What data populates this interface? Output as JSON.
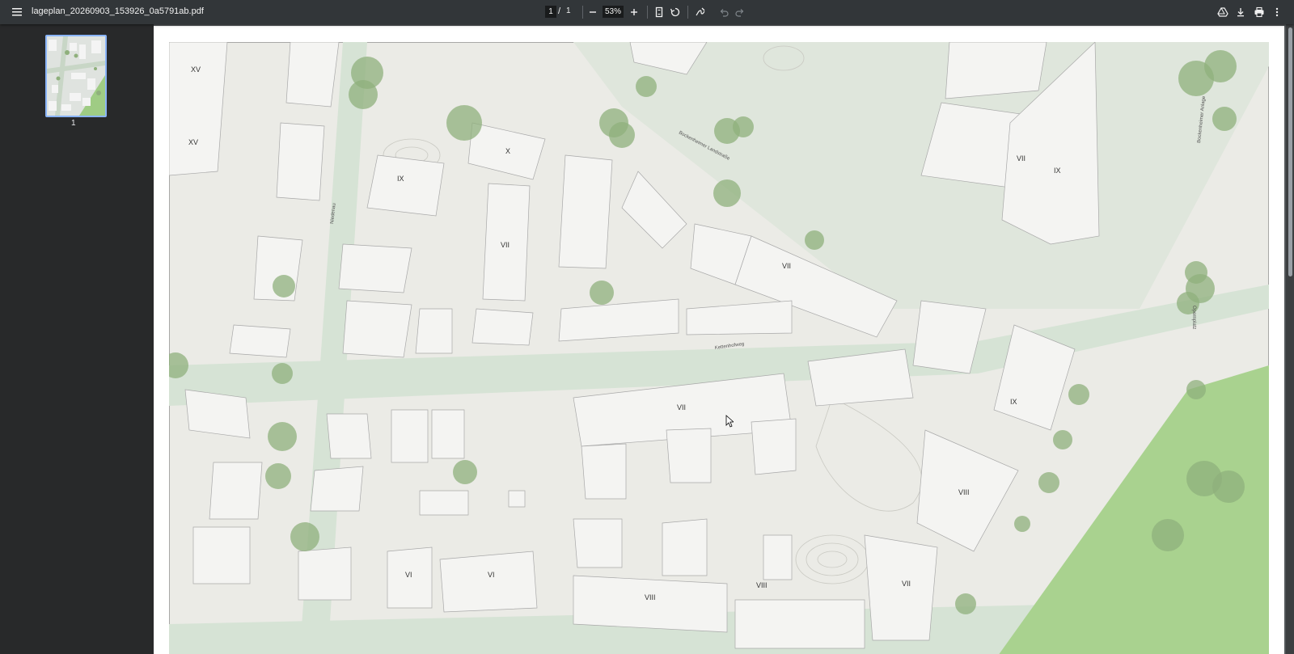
{
  "toolbar": {
    "filename": "lageplan_20260903_153926_0a5791ab.pdf",
    "page_current": "1",
    "page_separator": "/",
    "page_total": "1",
    "zoom": "53%"
  },
  "sidebar": {
    "thumb_page_number": "1"
  },
  "map": {
    "floor_labels": [
      "XV",
      "XV",
      "IX",
      "X",
      "VII",
      "VII",
      "VII",
      "IX",
      "VII",
      "IX",
      "VIII",
      "VI",
      "VI",
      "VIII",
      "VIII",
      "VII"
    ],
    "street_labels": [
      "Bockenheimer Landstraße",
      "Kettenhofweg",
      "Niedenau",
      "Opernplatz",
      "Bockenheimer Anlage"
    ]
  },
  "colors": {
    "toolbar_bg": "#323639",
    "sidebar_bg": "#28292a",
    "viewer_bg": "#525659",
    "accent": "#8ab4f8",
    "park_green": "#a9d28f",
    "tree_green": "#8fb07c",
    "building": "#e8e8e8",
    "street": "#d6e3d5"
  }
}
